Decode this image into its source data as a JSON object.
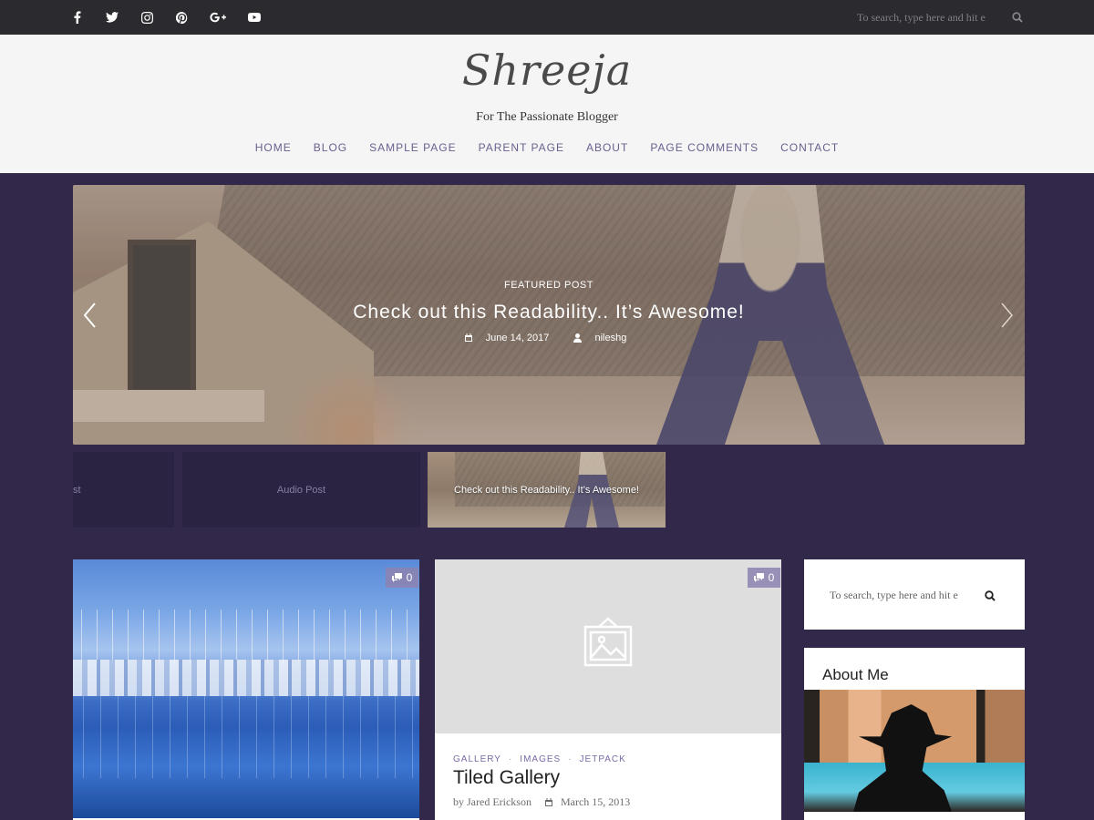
{
  "topbar": {
    "social_icons": [
      "facebook-icon",
      "twitter-icon",
      "instagram-icon",
      "pinterest-icon",
      "google-plus-icon",
      "youtube-icon"
    ],
    "search_placeholder": "To search, type here and hit e"
  },
  "header": {
    "logo": "Shreeja",
    "tagline": "For The Passionate Blogger",
    "nav": [
      "HOME",
      "BLOG",
      "SAMPLE PAGE",
      "PARENT PAGE",
      "ABOUT",
      "PAGE COMMENTS",
      "CONTACT"
    ]
  },
  "slider": {
    "label": "FEATURED POST",
    "title": "Check out this Readability.. It’s Awesome!",
    "date": "June 14, 2017",
    "author": "nileshg"
  },
  "thumbnails": [
    {
      "title": "st"
    },
    {
      "title": "Audio Post"
    },
    {
      "title": "Check out this Readability.. It’s Awesome!"
    }
  ],
  "posts": [
    {
      "comments": "0"
    },
    {
      "comments": "0",
      "categories": [
        "GALLERY",
        "IMAGES",
        "JETPACK"
      ],
      "title": "Tiled Gallery",
      "author": "by Jared Erickson",
      "date": "March 15, 2013"
    }
  ],
  "sidebar": {
    "search_placeholder": "To search, type here and hit e",
    "about_title": "About Me"
  },
  "colors": {
    "background": "#31284a",
    "accent": "#6b5f8e",
    "topbar": "#2b2b2f"
  }
}
